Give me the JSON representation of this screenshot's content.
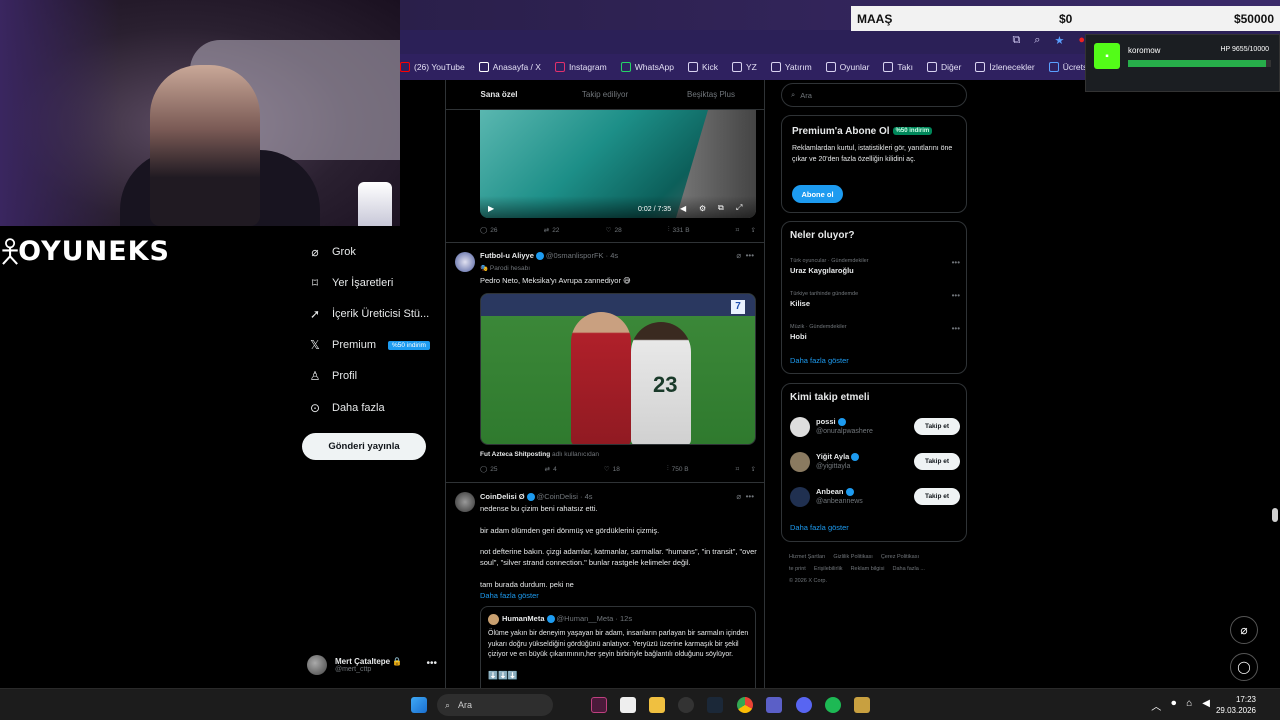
{
  "browser": {
    "bookmarks": [
      {
        "label": "(26) YouTube",
        "color": "#ff0000"
      },
      {
        "label": "Anasayfa / X",
        "color": "#ffffff"
      },
      {
        "label": "Instagram",
        "color": "#e1306c"
      },
      {
        "label": "WhatsApp",
        "color": "#25d366"
      },
      {
        "label": "Kick",
        "color": "#d8d2f0"
      },
      {
        "label": "YZ",
        "color": "#d8d2f0"
      },
      {
        "label": "Yatırım",
        "color": "#d8d2f0"
      },
      {
        "label": "Oyunlar",
        "color": "#d8d2f0"
      },
      {
        "label": "Takı",
        "color": "#d8d2f0"
      },
      {
        "label": "Diğer",
        "color": "#d8d2f0"
      },
      {
        "label": "İzlenecekler",
        "color": "#d8d2f0"
      },
      {
        "label": "Ücretsiz Online Resi...",
        "color": "#5aa0ff"
      }
    ]
  },
  "overlay": {
    "logo_text": "OYUNEKS",
    "money_label": "MAAŞ",
    "money_current": "$0",
    "money_goal": "$50000",
    "kick_user": "koromow",
    "hp_text": "HP 9655/10000",
    "hp_fraction": 0.9655
  },
  "nav": {
    "items": [
      {
        "label": "Grok",
        "icon": "grok-icon",
        "glyph": "⌀"
      },
      {
        "label": "Yer İşaretleri",
        "icon": "bookmark-icon",
        "glyph": "⌑"
      },
      {
        "label": "İçerik Üreticisi Stü...",
        "icon": "rocket-icon",
        "glyph": "➚"
      },
      {
        "label": "Premium",
        "icon": "x-logo-icon",
        "glyph": "𝕏",
        "badge": "%50 indirim"
      },
      {
        "label": "Profil",
        "icon": "person-icon",
        "glyph": "♙"
      },
      {
        "label": "Daha fazla",
        "icon": "more-circle-icon",
        "glyph": "⊙"
      }
    ],
    "post_button": "Gönderi yayınla",
    "account_name": "Mert Çataltepe",
    "account_handle": "@mert_cttp"
  },
  "feed": {
    "tabs": [
      "Sana özel",
      "Takip ediliyor",
      "Beşiktaş Plus"
    ],
    "video1": {
      "time": "0:02 / 7:35",
      "replies": "26",
      "reposts": "22",
      "likes": "28",
      "views": "331 B"
    },
    "post2": {
      "name": "Futbol-u Aliyye",
      "handle": "@0smanlisporFK",
      "time": "4s",
      "sub": "Parodi hesabı",
      "text": "Pedro Neto, Meksika'yı Avrupa zannediyor 😅",
      "media_caption_bold": "Fut Azteca Shitposting",
      "media_caption_rest": "adlı kullanıcıdan",
      "replies": "25",
      "reposts": "4",
      "likes": "18",
      "views": "750 B"
    },
    "post3": {
      "name": "CoinDelisi Ø",
      "handle": "@CoinDelisi",
      "time": "4s",
      "line1": "nedense bu çizim beni rahatsız etti.",
      "line2": "bir adam ölümden geri dönmüş ve gördüklerini çizmiş.",
      "line3": "not defterine bakın. çizgi adamlar, katmanlar, sarmallar. \"humans\", \"in transit\", \"over soul\", \"silver strand connection.\" bunlar rastgele kelimeler değil.",
      "line4": "tam burada durdum. peki ne",
      "more": "Daha fazla göster",
      "quote_name": "HumanMeta",
      "quote_handle": "@Human__Meta",
      "quote_time": "12s",
      "quote_text": "Ölüme yakın bir deneyim yaşayan bir adam, insanların parlayan bir sarmalın içinden yukarı doğru yükseldiğini gördüğünü anlatıyor. Yeryüzü üzerine karmaşık bir şekil çiziyor ve en büyük çıkarımının,her şeyin birbiriyle bağlantılı olduğunu söylüyor.",
      "quote_emoji": "⬇️⬇️⬇️"
    }
  },
  "right": {
    "search_placeholder": "Ara",
    "premium_title": "Premium'a Abone Ol",
    "premium_badge": "%50 indirim",
    "premium_text": "Reklamlardan kurtul, istatistikleri gör, yanıtlarını öne çıkar ve 20'den fazla özelliğin kilidini aç.",
    "premium_button": "Abone ol",
    "trends_title": "Neler oluyor?",
    "trends": [
      {
        "meta": "Türk oyuncular · Gündemdekiler",
        "name": "Uraz Kaygılaroğlu"
      },
      {
        "meta": "Türkiye tarihinde gündemde",
        "name": "Kilise"
      },
      {
        "meta": "Müzik · Gündemdekiler",
        "name": "Hobi"
      }
    ],
    "trends_more": "Daha fazla göster",
    "follow_title": "Kimi takip etmeli",
    "follow": [
      {
        "name": "possi",
        "handle": "@onuralpwashere",
        "button": "Takip et",
        "color": "#ddd"
      },
      {
        "name": "Yiğit Ayla",
        "handle": "@yigittayla",
        "button": "Takip et",
        "color": "#8a7a60"
      },
      {
        "name": "Anbean",
        "handle": "@anbeannews",
        "button": "Takip et",
        "color": "#203050"
      }
    ],
    "follow_more": "Daha fazla göster",
    "footer": [
      "Hizmet Şartları",
      "Gizlilik Politikası",
      "Çerez Politikası",
      "te print",
      "Erişilebilirlik",
      "Reklam bilgisi",
      "Daha fazla ...",
      "© 2026 X Corp."
    ]
  },
  "taskbar": {
    "search": "Ara",
    "time": "17:23",
    "date": "29.03.2026"
  }
}
